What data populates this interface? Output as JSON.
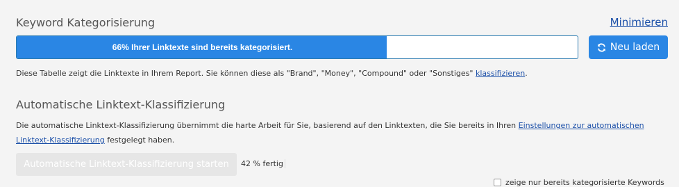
{
  "keyword_section": {
    "title": "Keyword Kategorisierung",
    "minimize_label": "Minimieren",
    "progress_percent": 66,
    "progress_text": "66% Ihrer Linktexte sind bereits kategorisiert.",
    "reload_label": "Neu laden",
    "description": "Diese Tabelle zeigt die Linktexte in Ihrem Report. Sie können diese als \"Brand\", \"Money\", \"Compound\" oder \"Sonstiges\"",
    "description_link": "klassifizieren",
    "description_end": "."
  },
  "auto_section": {
    "title": "Automatische Linktext-Klassifizierung",
    "description": "Die automatische Linktext-Klassifizierung übernimmt die harte Arbeit für Sie, basierend auf den Linktexten, die Sie bereits in Ihren",
    "description_link": "Einstellungen zur automatischen Linktext-Klassifizierung",
    "description_end": "festgelegt haben.",
    "start_label": "Automatische Linktext-Klassifizierung starten",
    "progress_percent": 42,
    "progress_status": "42 % fertig",
    "filter_label": "zeige nur bereits kategorisierte Keywords"
  },
  "icons": {
    "reload": "refresh-icon"
  },
  "colors": {
    "accent": "#2a86e4",
    "link": "#1b4fa8",
    "background": "#f4f4f4"
  }
}
